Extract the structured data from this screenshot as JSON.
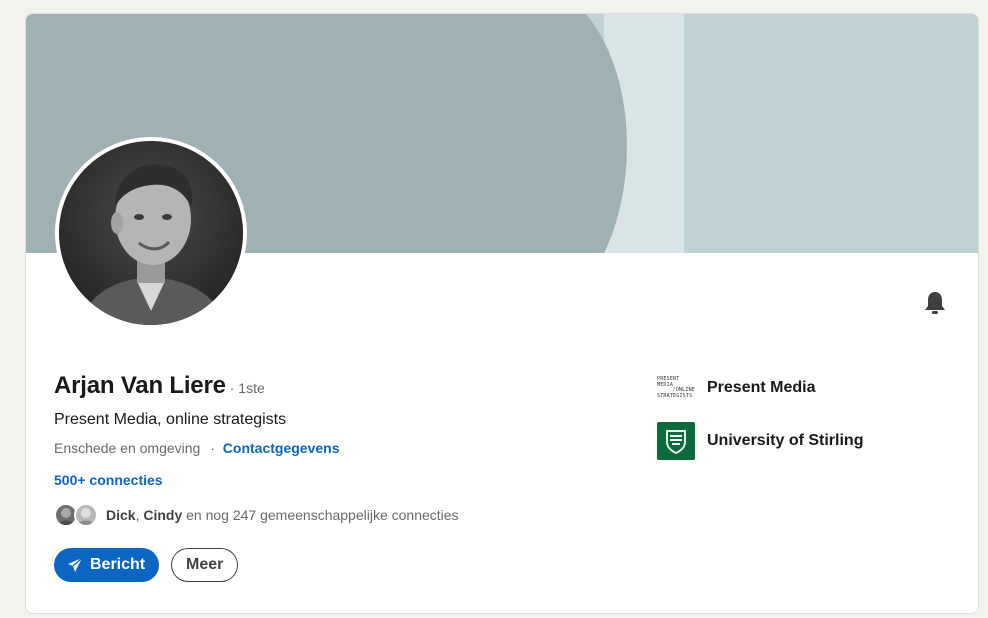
{
  "profile": {
    "name": "Arjan Van Liere",
    "degree": "· 1ste",
    "headline": "Present Media, online strategists",
    "location": "Enschede en omgeving",
    "location_separator": "·",
    "contact_link": "Contactgegevens",
    "connections": "500+ connecties",
    "mutual": {
      "name1": "Dick",
      "comma": ",",
      "name2": "Cindy",
      "rest": "en nog 247 gemeenschappelijke connecties"
    }
  },
  "actions": {
    "message_label": "Bericht",
    "more_label": "Meer"
  },
  "companies": [
    {
      "name": "Present Media",
      "logo_lines": [
        "PRESENT",
        "MEDIA",
        "/ONLINE",
        "STRATEGISTS"
      ]
    },
    {
      "name": "University of Stirling"
    }
  ],
  "icons": {
    "bell": "bell-icon",
    "send": "paper-plane-icon"
  },
  "colors": {
    "primary": "#0a66c2",
    "cover_left": "#a0b1b4",
    "cover_right": "#bfd3d6",
    "cover_band": "#d9e4e6",
    "university_green": "#0b6b3a"
  }
}
